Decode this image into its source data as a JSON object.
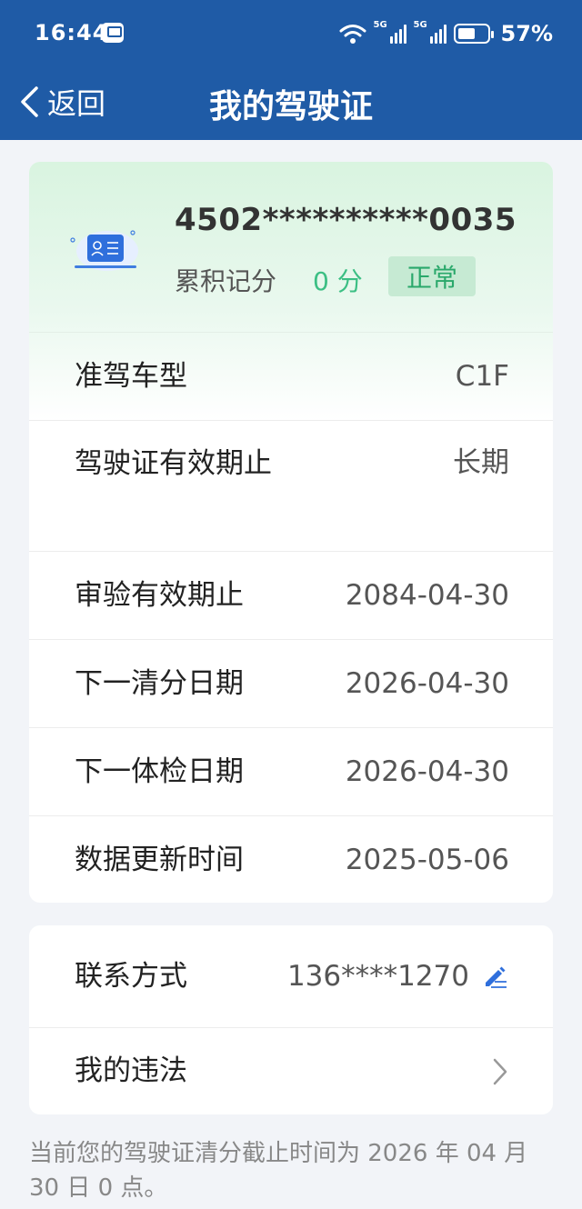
{
  "status_bar": {
    "time": "16:44",
    "network_1": "5G",
    "network_2": "5G",
    "battery": "57%"
  },
  "nav": {
    "back_label": "返回",
    "title": "我的驾驶证"
  },
  "license": {
    "number": "4502**********0035",
    "points_label": "累积记分",
    "points_value": "0 分",
    "status": "正常",
    "icon": "id-card-icon"
  },
  "details": [
    {
      "label": "准驾车型",
      "value": "C1F"
    },
    {
      "label": "驾驶证有效期止",
      "value": "长期"
    },
    {
      "label": "审验有效期止",
      "value": "2084-04-30"
    },
    {
      "label": "下一清分日期",
      "value": "2026-04-30"
    },
    {
      "label": "下一体检日期",
      "value": "2026-04-30"
    },
    {
      "label": "数据更新时间",
      "value": "2025-05-06"
    }
  ],
  "contact": {
    "label": "联系方式",
    "value": "136****1270",
    "icon": "edit-icon"
  },
  "violations": {
    "label": "我的违法",
    "icon": "chevron-right-icon"
  },
  "notice": "当前您的驾驶证清分截止时间为 2026 年 04 月 30 日 0 点。",
  "colors": {
    "header": "#1f5ba6",
    "accent_green": "#3cbf84",
    "badge_bg": "#c6ead3"
  }
}
